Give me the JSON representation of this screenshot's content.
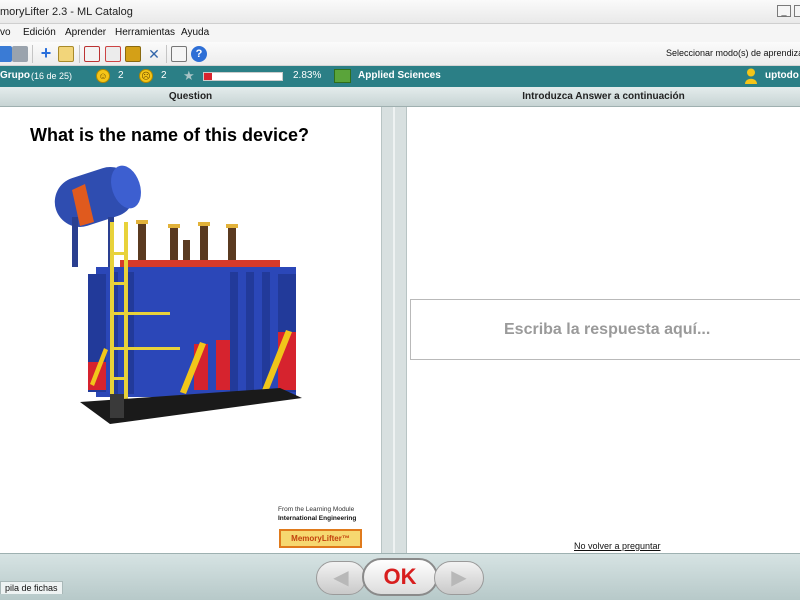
{
  "window": {
    "title": "moryLifter 2.3 - ML Catalog"
  },
  "menu": {
    "items": [
      "vo",
      "Edición",
      "Aprender",
      "Herramientas",
      "Ayuda"
    ]
  },
  "toolbar": {
    "mode_label": "Seleccionar modo(s) de aprendizaje"
  },
  "status": {
    "group": "Grupo",
    "group_count": "(16 de 25)",
    "happy_count": "2",
    "neutral_count": "2",
    "progress_percent": 2.83,
    "progress_label": "2.83%",
    "category": "Applied Sciences",
    "user": "uptodo"
  },
  "question_panel": {
    "header": "Question",
    "question": "What is the name of this device?",
    "credit_line1": "From the Learning Module",
    "credit_line2": "International Engineering",
    "logo_text": "MemoryLifter™"
  },
  "answer_panel": {
    "header": "Introduzca Answer a continuación",
    "placeholder": "Escriba la respuesta aquí...",
    "no_ask_link": "No volver a preguntar"
  },
  "bottom": {
    "stack_tab": "pila de fichas",
    "ok_label": "OK",
    "back_arrow": "◀",
    "next_arrow": "▶"
  },
  "colors": {
    "status_bar": "#2b7f86",
    "ok_text": "#d81e1e",
    "progress_fill": "#d8242e"
  }
}
